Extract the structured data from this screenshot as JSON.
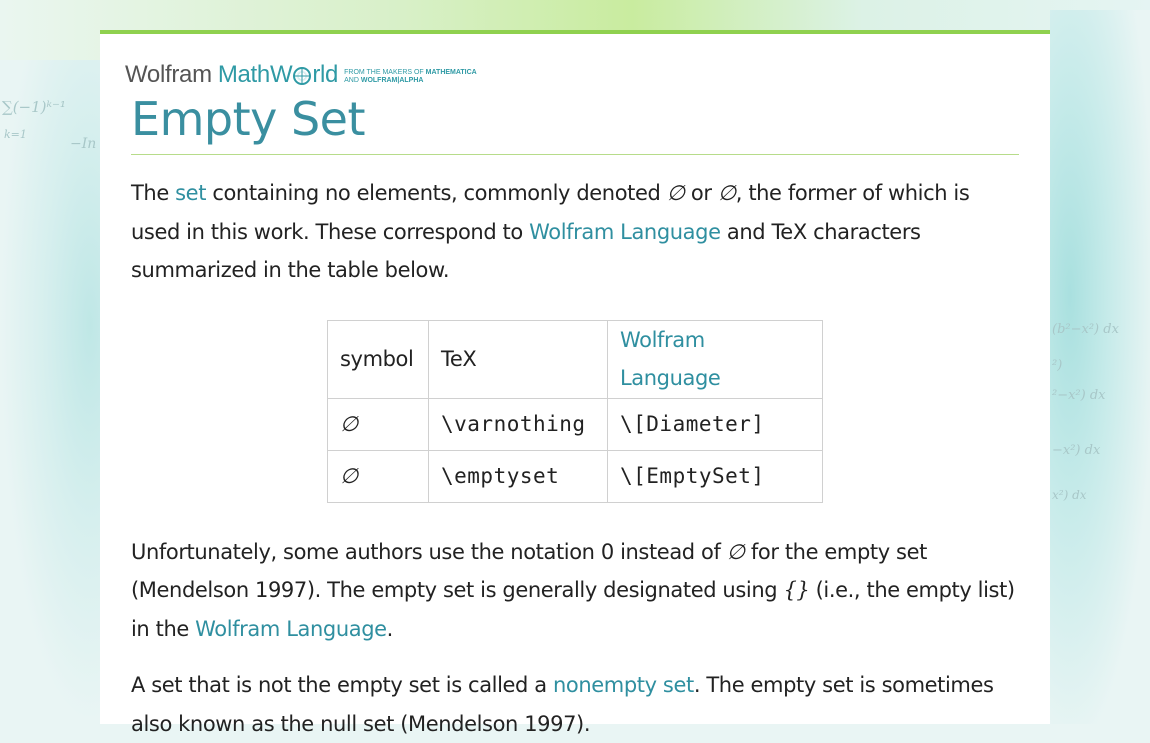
{
  "brand": {
    "wolfram": "Wolfram",
    "mathworld_pre": "MathW",
    "mathworld_post": "rld",
    "tagline_line1": "FROM THE MAKERS OF",
    "tagline_product1": "MATHEMATICA",
    "tagline_line2": "AND",
    "tagline_product2": "WOLFRAM|ALPHA"
  },
  "page": {
    "title": "Empty Set"
  },
  "paragraph1": {
    "t1": "The ",
    "link_set": "set",
    "t2": " containing no elements, commonly denoted ",
    "sym1": "∅",
    "t3": " or ",
    "sym2": "∅",
    "t4": ", the former of which is used in this work. These correspond to ",
    "link_wl": "Wolfram Language",
    "t5": " and TeX characters summarized in the table below."
  },
  "table": {
    "headers": [
      "symbol",
      "TeX",
      "Wolfram Language"
    ],
    "rows": [
      [
        "∅",
        "\\varnothing",
        "\\[Diameter]"
      ],
      [
        "∅",
        "\\emptyset",
        "\\[EmptySet]"
      ]
    ]
  },
  "paragraph2": {
    "t1": "Unfortunately, some authors use the notation 0 instead of ",
    "sym": "∅",
    "t2": " for the empty set (Mendelson 1997). The empty set is generally designated using ",
    "braces": "{}",
    "t3": " (i.e., the empty list) in the ",
    "link_wl": "Wolfram Language",
    "t4": "."
  },
  "paragraph3": {
    "t1": "A set that is not the empty set is called a ",
    "link_nonempty": "nonempty set",
    "t2": ". The empty set is sometimes also known as the null set (Mendelson 1997)."
  },
  "colors": {
    "accent_teal": "#3a8fa0",
    "link": "#2f8fa0",
    "top_border_green": "#8fd14f",
    "rule_green": "#b7dc8a"
  }
}
